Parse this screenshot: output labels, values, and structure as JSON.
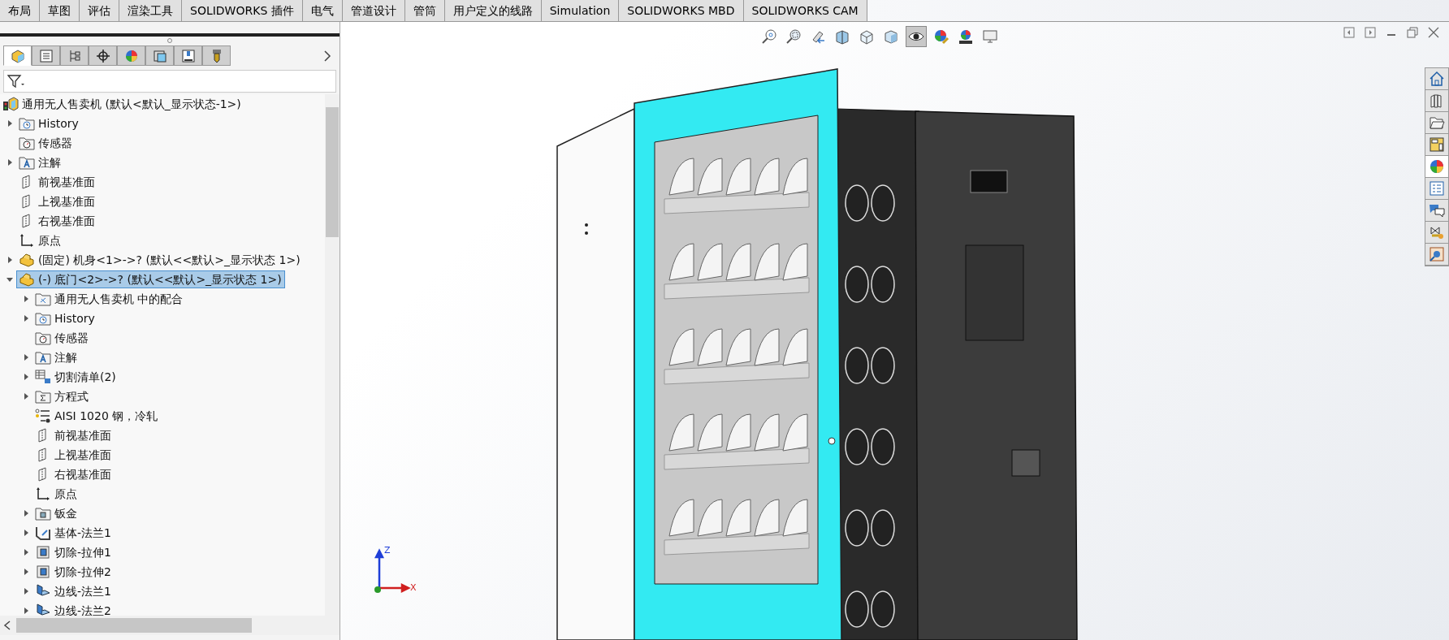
{
  "ribbon_tabs": [
    {
      "label": "布局",
      "selected": false
    },
    {
      "label": "草图",
      "selected": false
    },
    {
      "label": "评估",
      "selected": false
    },
    {
      "label": "渲染工具",
      "selected": false
    },
    {
      "label": "SOLIDWORKS 插件",
      "selected": false
    },
    {
      "label": "电气",
      "selected": false
    },
    {
      "label": "管道设计",
      "selected": false
    },
    {
      "label": "管筒",
      "selected": false
    },
    {
      "label": "用户定义的线路",
      "selected": false
    },
    {
      "label": "Simulation",
      "selected": false
    },
    {
      "label": "SOLIDWORKS MBD",
      "selected": false
    },
    {
      "label": "SOLIDWORKS CAM",
      "selected": false
    }
  ],
  "manager_tabs": [
    {
      "kind": "feature",
      "selected": true
    },
    {
      "kind": "property",
      "selected": false
    },
    {
      "kind": "config",
      "selected": false
    },
    {
      "kind": "dimxpert",
      "selected": false
    },
    {
      "kind": "display",
      "selected": false
    },
    {
      "kind": "cam",
      "selected": false
    },
    {
      "kind": "camtree",
      "selected": false
    },
    {
      "kind": "tool",
      "selected": false
    }
  ],
  "tree": [
    {
      "kind": "assembly",
      "label": "通用无人售卖机  (默认<默认_显示状态-1>)",
      "selected": false,
      "children": [
        {
          "kind": "history",
          "label": "History",
          "expanded": false,
          "selected": false
        },
        {
          "kind": "sensor",
          "label": "传感器",
          "selected": false
        },
        {
          "kind": "annotation",
          "label": "注解",
          "expanded": false,
          "selected": false
        },
        {
          "kind": "plane",
          "label": "前视基准面",
          "selected": false
        },
        {
          "kind": "plane",
          "label": "上视基准面",
          "selected": false
        },
        {
          "kind": "plane",
          "label": "右视基准面",
          "selected": false
        },
        {
          "kind": "origin",
          "label": "原点",
          "selected": false
        },
        {
          "kind": "part",
          "label": "(固定) 机身<1>->? (默认<<默认>_显示状态 1>)",
          "expanded": false,
          "selected": false
        },
        {
          "kind": "part",
          "label": "(-) 底门<2>->? (默认<<默认>_显示状态 1>)",
          "expanded": true,
          "selected": true,
          "children": [
            {
              "kind": "mates",
              "label": "通用无人售卖机 中的配合",
              "expanded": false,
              "selected": false
            },
            {
              "kind": "history",
              "label": "History",
              "expanded": false,
              "selected": false
            },
            {
              "kind": "sensor",
              "label": "传感器",
              "selected": false
            },
            {
              "kind": "annotation",
              "label": "注解",
              "expanded": false,
              "selected": false
            },
            {
              "kind": "cutlist",
              "label": "切割清单(2)",
              "expanded": false,
              "selected": false
            },
            {
              "kind": "equations",
              "label": "方程式",
              "expanded": false,
              "selected": false
            },
            {
              "kind": "material",
              "label": "AISI 1020 钢，冷轧",
              "selected": false
            },
            {
              "kind": "plane",
              "label": "前视基准面",
              "selected": false
            },
            {
              "kind": "plane",
              "label": "上视基准面",
              "selected": false
            },
            {
              "kind": "plane",
              "label": "右视基准面",
              "selected": false
            },
            {
              "kind": "origin",
              "label": "原点",
              "selected": false
            },
            {
              "kind": "sheetmetal",
              "label": "钣金",
              "expanded": false,
              "selected": false
            },
            {
              "kind": "baseflange",
              "label": "基体-法兰1",
              "expanded": false,
              "selected": false
            },
            {
              "kind": "cut",
              "label": "切除-拉伸1",
              "expanded": false,
              "selected": false
            },
            {
              "kind": "cut",
              "label": "切除-拉伸2",
              "expanded": false,
              "selected": false
            },
            {
              "kind": "edgeflange",
              "label": "边线-法兰1",
              "expanded": false,
              "selected": false
            },
            {
              "kind": "edgeflange",
              "label": "边线-法兰2",
              "expanded": false,
              "selected": false
            }
          ]
        }
      ]
    }
  ],
  "view_toolbar": [
    {
      "kind": "zoom-fit",
      "selected": false
    },
    {
      "kind": "zoom-area",
      "selected": false
    },
    {
      "kind": "previous",
      "selected": false
    },
    {
      "kind": "section",
      "selected": false
    },
    {
      "kind": "orientation",
      "selected": false
    },
    {
      "kind": "display-style",
      "selected": false
    },
    {
      "kind": "hide-show",
      "selected": true
    },
    {
      "kind": "edit-appearance",
      "selected": false
    },
    {
      "kind": "scene",
      "selected": false
    },
    {
      "kind": "view-settings",
      "selected": false
    }
  ],
  "task_pane": [
    {
      "kind": "home",
      "selected": false
    },
    {
      "kind": "library",
      "selected": false
    },
    {
      "kind": "explorer",
      "selected": false
    },
    {
      "kind": "palette",
      "selected": false
    },
    {
      "kind": "appearance",
      "selected": true
    },
    {
      "kind": "properties",
      "selected": false
    },
    {
      "kind": "forum",
      "selected": false
    },
    {
      "kind": "routing",
      "selected": false
    },
    {
      "kind": "recognizer",
      "selected": false
    }
  ],
  "triad": {
    "z_label": "Z",
    "x_label": "X"
  }
}
